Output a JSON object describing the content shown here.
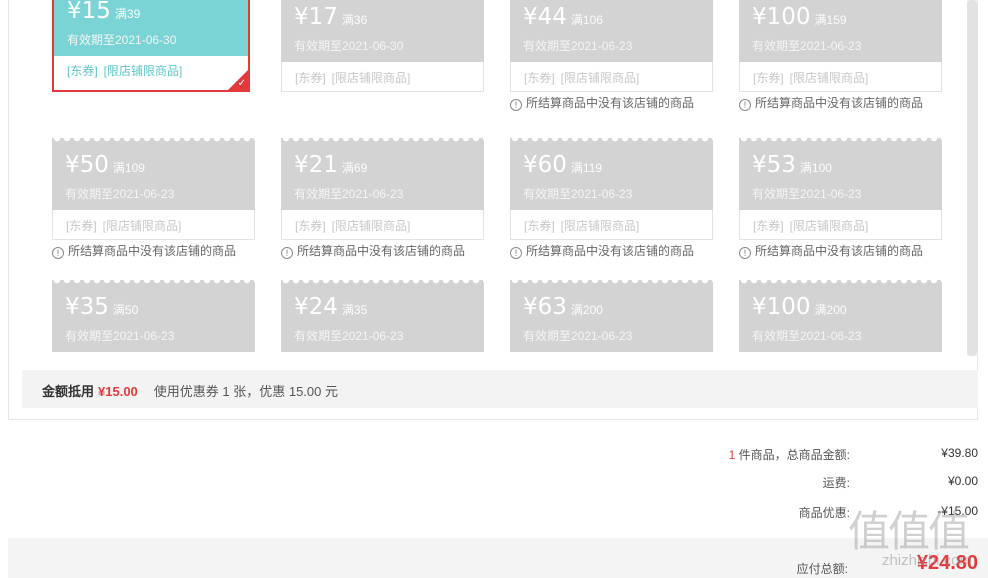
{
  "coupons": [
    {
      "amount": "¥15",
      "cond": "满39",
      "valid": "有效期至2021-06-30",
      "tag1": "[东券]",
      "tag2": "[限店铺限商品]",
      "warning": "",
      "selected": true
    },
    {
      "amount": "¥17",
      "cond": "满36",
      "valid": "有效期至2021-06-30",
      "tag1": "[东券]",
      "tag2": "[限店铺限商品]",
      "warning": ""
    },
    {
      "amount": "¥44",
      "cond": "满106",
      "valid": "有效期至2021-06-23",
      "tag1": "[东券]",
      "tag2": "[限店铺限商品]",
      "warning": "所结算商品中没有该店铺的商品"
    },
    {
      "amount": "¥100",
      "cond": "满159",
      "valid": "有效期至2021-06-23",
      "tag1": "[东券]",
      "tag2": "[限店铺限商品]",
      "warning": "所结算商品中没有该店铺的商品"
    },
    {
      "amount": "¥50",
      "cond": "满109",
      "valid": "有效期至2021-06-23",
      "tag1": "[东券]",
      "tag2": "[限店铺限商品]",
      "warning": "所结算商品中没有该店铺的商品"
    },
    {
      "amount": "¥21",
      "cond": "满69",
      "valid": "有效期至2021-06-23",
      "tag1": "[东券]",
      "tag2": "[限店铺限商品]",
      "warning": "所结算商品中没有该店铺的商品"
    },
    {
      "amount": "¥60",
      "cond": "满119",
      "valid": "有效期至2021-06-23",
      "tag1": "[东券]",
      "tag2": "[限店铺限商品]",
      "warning": "所结算商品中没有该店铺的商品"
    },
    {
      "amount": "¥53",
      "cond": "满100",
      "valid": "有效期至2021-06-23",
      "tag1": "[东券]",
      "tag2": "[限店铺限商品]",
      "warning": "所结算商品中没有该店铺的商品"
    },
    {
      "amount": "¥35",
      "cond": "满50",
      "valid": "有效期至2021-06-23",
      "tag1": "",
      "tag2": "",
      "warning": ""
    },
    {
      "amount": "¥24",
      "cond": "满35",
      "valid": "有效期至2021-06-23",
      "tag1": "",
      "tag2": "",
      "warning": ""
    },
    {
      "amount": "¥63",
      "cond": "满200",
      "valid": "有效期至2021-06-23",
      "tag1": "",
      "tag2": "",
      "warning": ""
    },
    {
      "amount": "¥100",
      "cond": "满200",
      "valid": "有效期至2021-06-23",
      "tag1": "",
      "tag2": "",
      "warning": ""
    }
  ],
  "summary": {
    "label": "金额抵用",
    "amount": "¥15.00",
    "info": "使用优惠券 1 张，优惠 15.00 元"
  },
  "totals": {
    "count": "1",
    "items_label": "件商品，总商品金额:",
    "items_value": "¥39.80",
    "shipping_label": "运费:",
    "shipping_value": "¥0.00",
    "discount_label": "商品优惠:",
    "discount_value": "-¥15.00",
    "pay_label": "应付总额:",
    "pay_value": "¥24.80"
  },
  "watermark": {
    "logo": "值值值",
    "text": "zhizhizhi.com"
  },
  "colors": {
    "selected_coupon": "#7ad3d4",
    "disabled_coupon": "#d3d3d3",
    "accent_red": "#e4393c"
  }
}
